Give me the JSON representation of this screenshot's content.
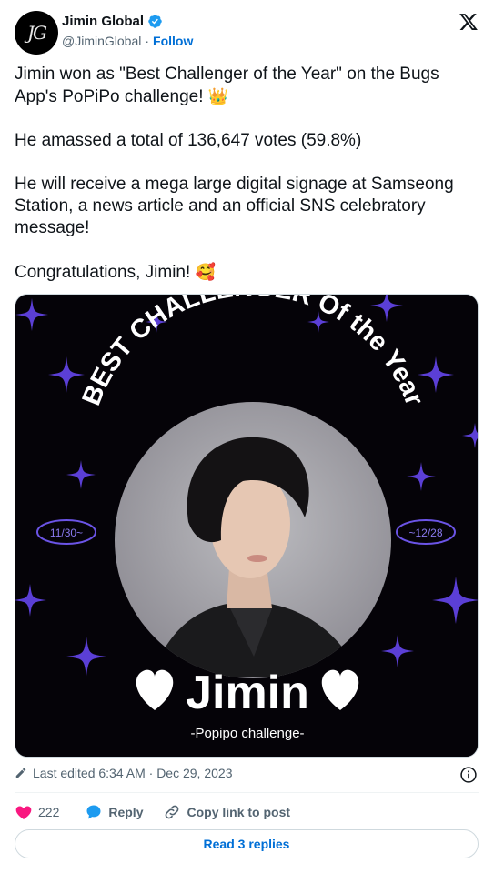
{
  "account": {
    "name": "Jimin Global",
    "handle": "@JiminGlobal",
    "separator": "·",
    "follow_label": "Follow",
    "avatar_monogram": "JG"
  },
  "tweet": {
    "lines": [
      "Jimin won as \"Best Challenger of the Year\" on the Bugs App's PoPiPo challenge!",
      "He amassed a total of 136,647 votes (59.8%)",
      "He will receive a mega large digital signage at Samseong Station, a news article and an official SNS celebratory message!",
      "Congratulations, Jimin!"
    ],
    "emoji_crown": "👑",
    "emoji_smile": "🥰"
  },
  "media": {
    "headline": "BEST CHALLENGER Of the Year",
    "date_left": "11/30~",
    "date_right": "~12/28",
    "artist": "Jimin",
    "subtitle": "-Popipo challenge-"
  },
  "meta": {
    "edited": "Last edited 6:34 AM · Dec 29, 2023"
  },
  "actions": {
    "like_count": "222",
    "reply_label": "Reply",
    "copy_label": "Copy link to post",
    "read_replies": "Read 3 replies"
  },
  "colors": {
    "link_blue": "#006fd6",
    "like_pink": "#f91880",
    "verified_blue": "#1d9bf0",
    "media_bg": "#050308",
    "star_purple": "#5b3fd6"
  }
}
